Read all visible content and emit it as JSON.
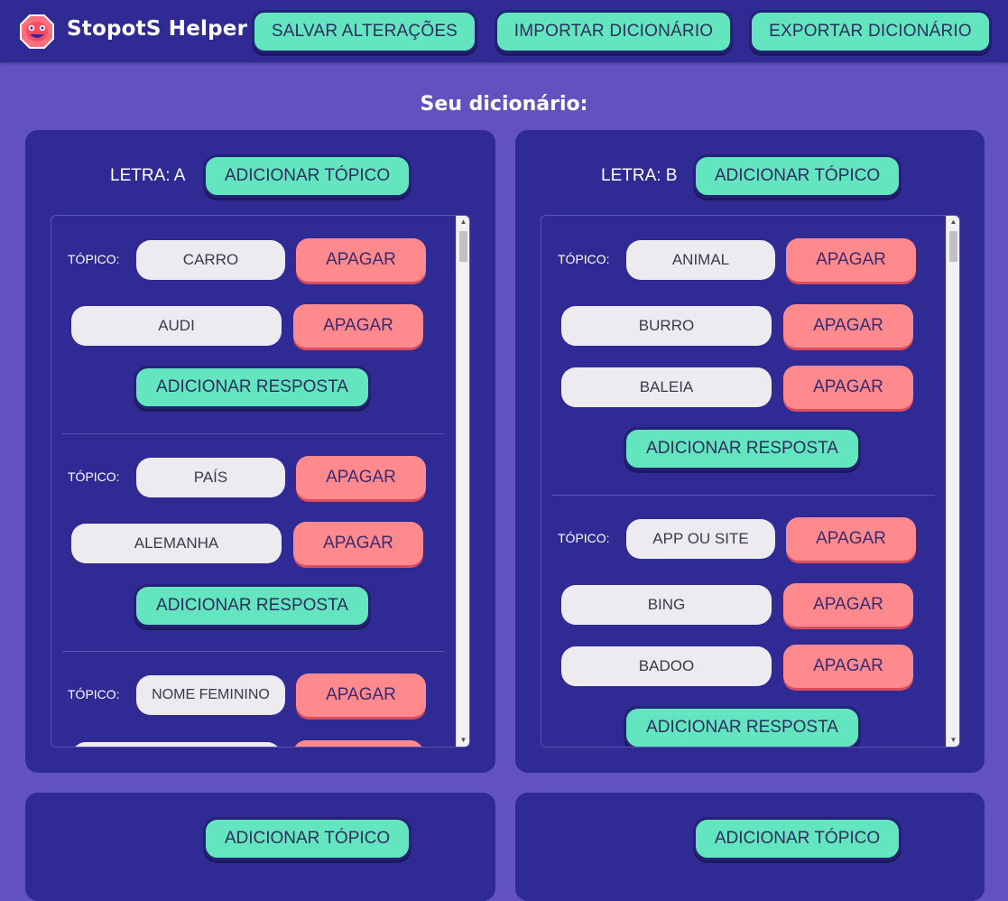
{
  "header": {
    "brand": "StopotS Helper",
    "logo_icon": "smiley-octagon-icon",
    "save_label": "SALVAR ALTERAÇÕES",
    "import_label": "IMPORTAR DICIONÁRIO",
    "export_label": "EXPORTAR DICIONÁRIO"
  },
  "page": {
    "title": "Seu dicionário:"
  },
  "colors": {
    "background": "#6152bf",
    "panel": "#302a95",
    "accent_green": "#63e6c0",
    "delete_red": "#ff8a8e",
    "field": "#edeaf0"
  },
  "labels": {
    "topic": "TÓPICO:",
    "delete": "APAGAR",
    "add_topic": "ADICIONAR TÓPICO",
    "add_answer": "ADICIONAR RESPOSTA"
  },
  "cards": [
    {
      "letter": "LETRA: A",
      "topics": [
        {
          "name": "CARRO",
          "answers": [
            "AUDI"
          ]
        },
        {
          "name": "PAÍS",
          "answers": [
            "ALEMANHA"
          ]
        },
        {
          "name": "NOME FEMININO",
          "answers": [
            ""
          ]
        }
      ]
    },
    {
      "letter": "LETRA: B",
      "topics": [
        {
          "name": "ANIMAL",
          "answers": [
            "BURRO",
            "BALEIA"
          ]
        },
        {
          "name": "APP OU SITE",
          "answers": [
            "BING",
            "BADOO"
          ]
        }
      ]
    }
  ]
}
